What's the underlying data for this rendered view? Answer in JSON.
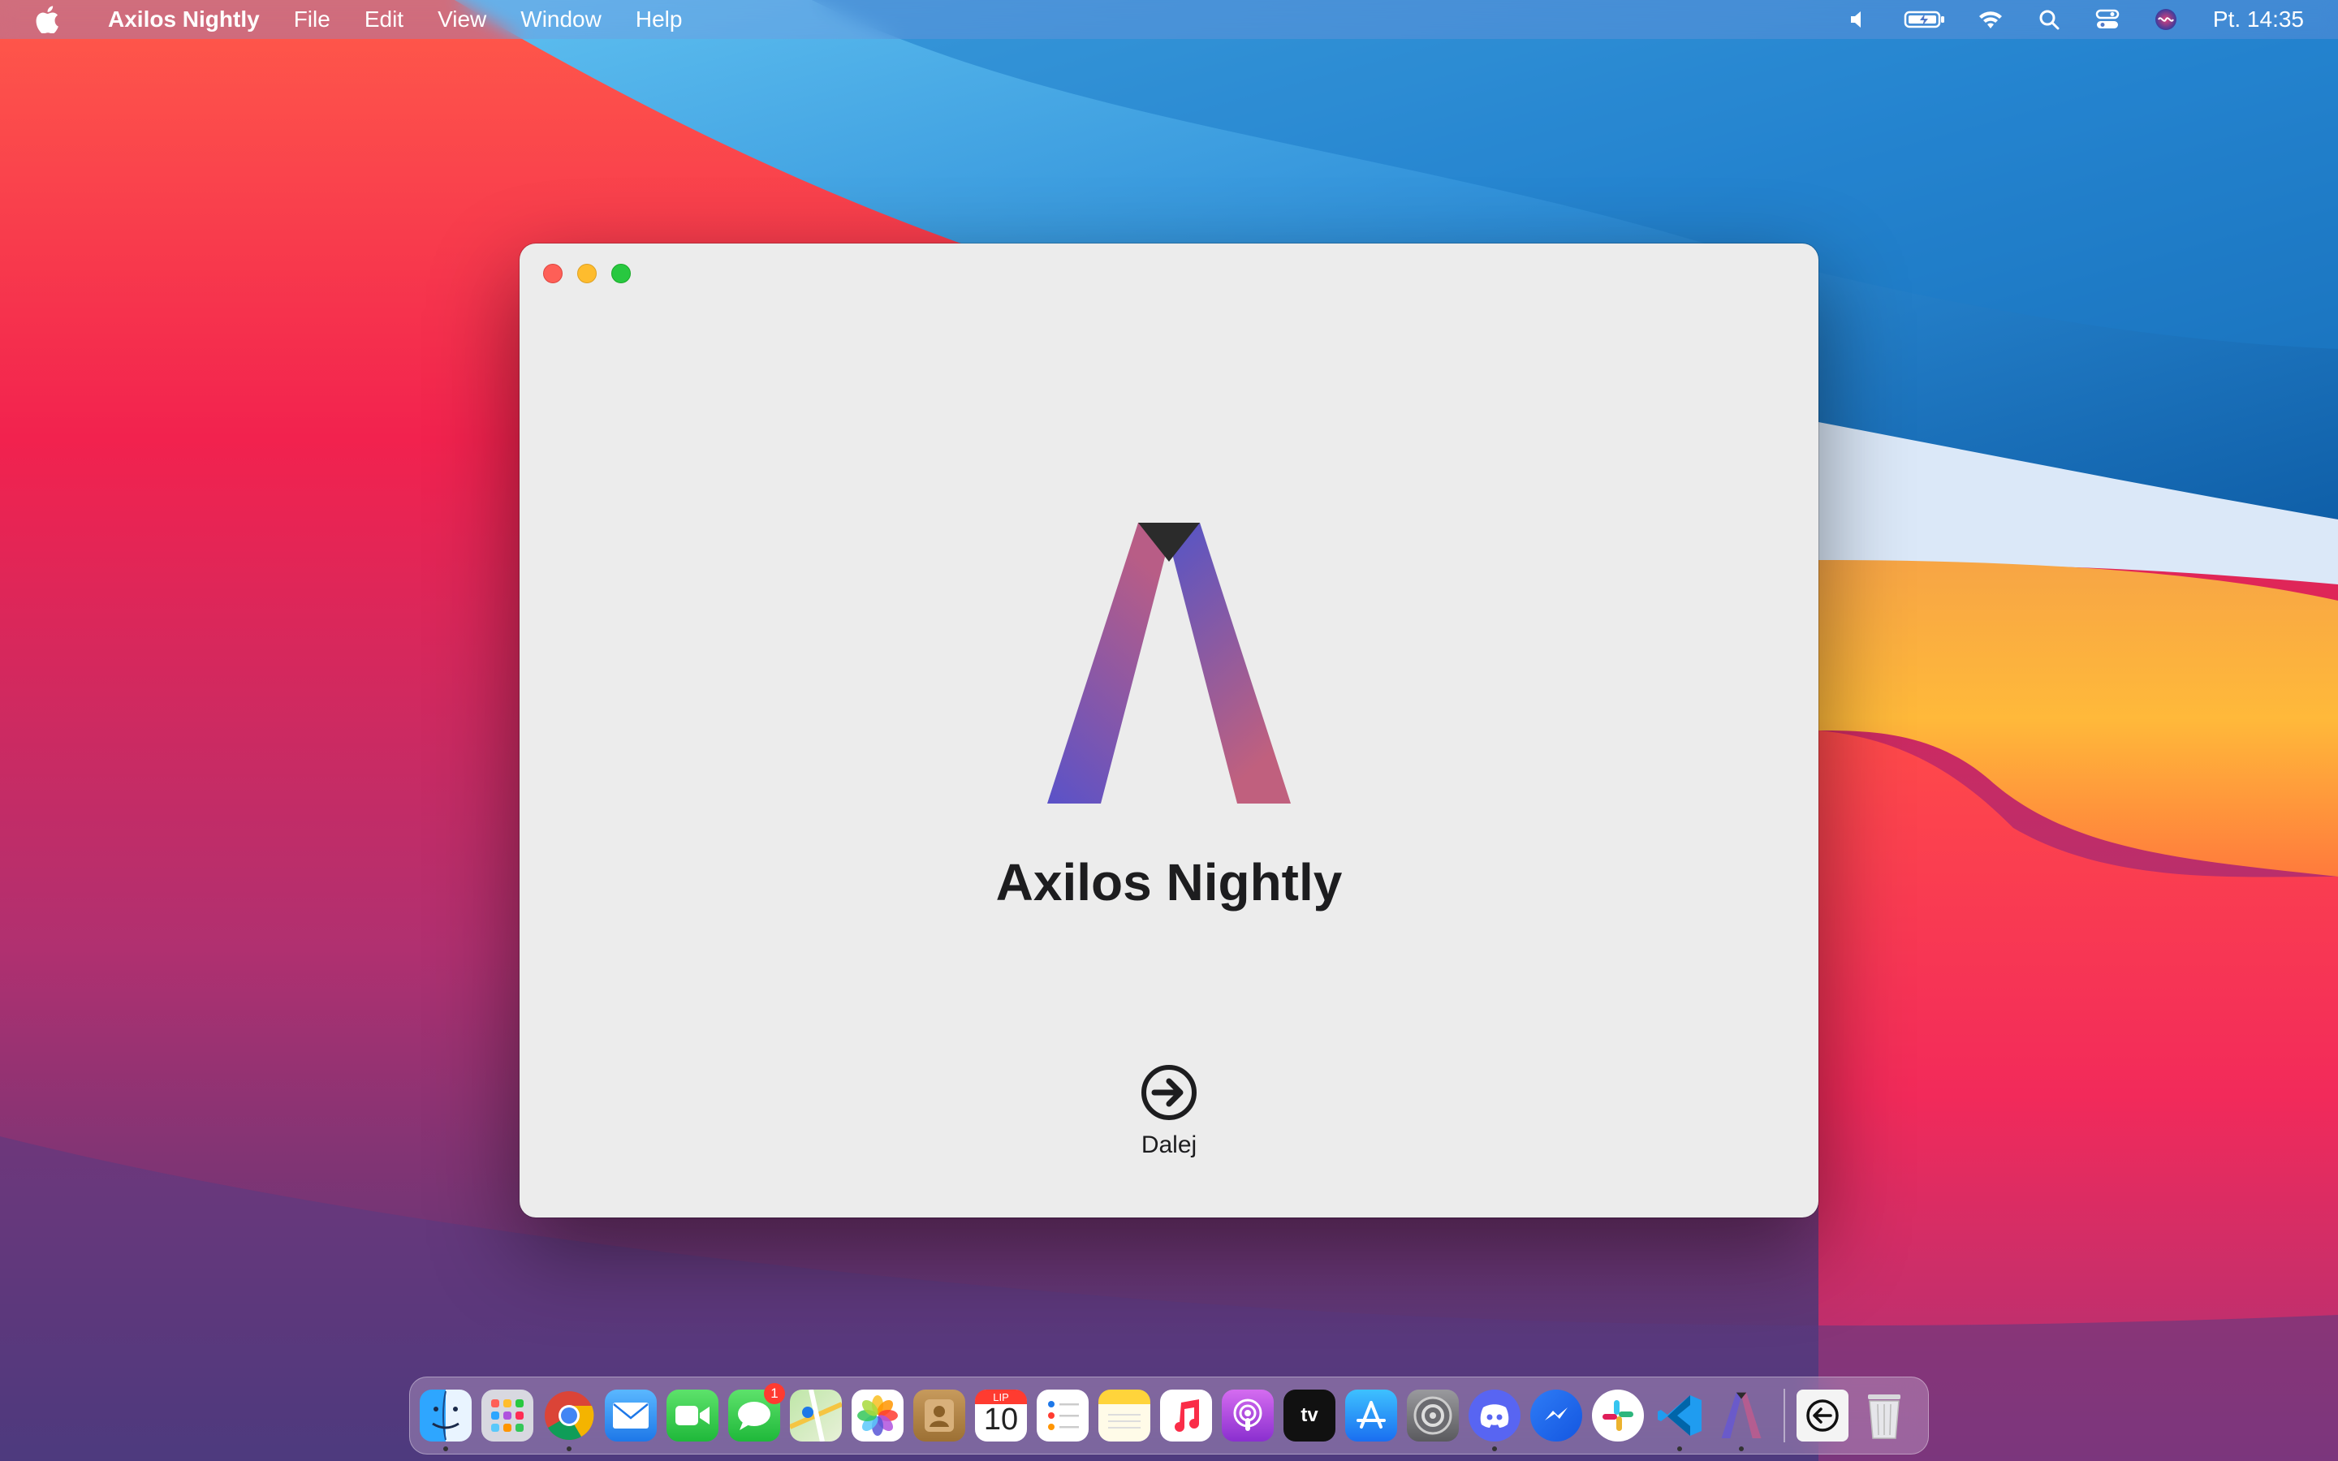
{
  "menubar": {
    "app_name": "Axilos Nightly",
    "items": [
      "File",
      "Edit",
      "View",
      "Window",
      "Help"
    ],
    "clock": "Pt. 14:35"
  },
  "window": {
    "title": "Axilos Nightly",
    "next_label": "Dalej"
  },
  "dock": {
    "apps": [
      {
        "icon": "finder-icon",
        "running": true
      },
      {
        "icon": "launchpad-icon",
        "running": false
      },
      {
        "icon": "chrome-icon",
        "running": true
      },
      {
        "icon": "mail-icon",
        "running": false
      },
      {
        "icon": "facetime-icon",
        "running": false
      },
      {
        "icon": "messages-icon",
        "running": false,
        "badge": "1"
      },
      {
        "icon": "maps-icon",
        "running": false
      },
      {
        "icon": "photos-icon",
        "running": false
      },
      {
        "icon": "contacts-icon",
        "running": false
      },
      {
        "icon": "calendar-icon",
        "running": false,
        "month": "LIP",
        "day": "10"
      },
      {
        "icon": "reminders-icon",
        "running": false
      },
      {
        "icon": "notes-icon",
        "running": false
      },
      {
        "icon": "music-icon",
        "running": false
      },
      {
        "icon": "podcasts-icon",
        "running": false
      },
      {
        "icon": "apple-tv-icon",
        "running": false,
        "label": "tv"
      },
      {
        "icon": "app-store-icon",
        "running": false
      },
      {
        "icon": "system-preferences-icon",
        "running": false
      },
      {
        "icon": "discord-icon",
        "running": true
      },
      {
        "icon": "messenger-icon",
        "running": false
      },
      {
        "icon": "slack-icon",
        "running": false
      },
      {
        "icon": "vscode-icon",
        "running": true
      },
      {
        "icon": "axilos-icon",
        "running": true
      },
      {
        "icon": "downloads-icon",
        "running": false
      },
      {
        "icon": "trash-icon",
        "running": false
      }
    ]
  }
}
